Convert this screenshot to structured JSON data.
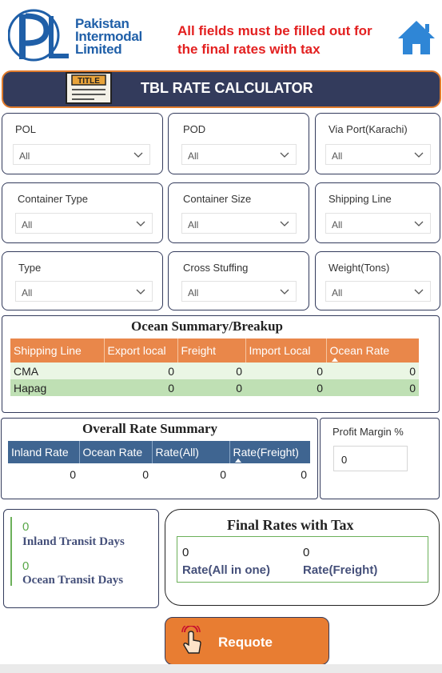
{
  "header": {
    "company_line1": "Pakistan",
    "company_line2": "Intermodal",
    "company_line3": "Limited",
    "notice_line1": "All fields must be filled out for",
    "notice_line2": "the final rates with tax",
    "home_icon": "home-icon",
    "logo_letters": "PL",
    "brand_color": "#1f5fa8",
    "notice_color": "#e32020"
  },
  "banner": {
    "title": "TBL RATE CALCULATOR",
    "icon_text": "TITLE",
    "background": "#333b5c",
    "border_color": "#e07b2c"
  },
  "filters": [
    {
      "label": "POL",
      "value": "All"
    },
    {
      "label": "POD",
      "value": "All"
    },
    {
      "label": "Via Port(Karachi)",
      "value": "All"
    },
    {
      "label": "Container Type",
      "value": "All"
    },
    {
      "label": "Container Size",
      "value": "All"
    },
    {
      "label": "Shipping Line",
      "value": "All"
    },
    {
      "label": "Type",
      "value": "All"
    },
    {
      "label": "Cross Stuffing",
      "value": "All"
    },
    {
      "label": "Weight(Tons)",
      "value": "All"
    }
  ],
  "ocean_summary": {
    "title": "Ocean Summary/Breakup",
    "columns": [
      "Shipping Line",
      "Export local",
      "Freight",
      "Import Local",
      "Ocean Rate"
    ],
    "sorted_column": "Ocean Rate",
    "rows": [
      [
        "CMA",
        "0",
        "0",
        "0",
        "0"
      ],
      [
        "Hapag",
        "0",
        "0",
        "0",
        "0"
      ]
    ],
    "header_color": "#e9874a"
  },
  "overall_summary": {
    "title": "Overall Rate Summary",
    "columns": [
      "Inland Rate",
      "Ocean Rate",
      "Rate(All)",
      "Rate(Freight)"
    ],
    "sorted_column": "Rate(Freight)",
    "rows": [
      [
        "0",
        "0",
        "0",
        "0"
      ]
    ],
    "header_color": "#3f6591"
  },
  "profit": {
    "label": "Profit Margin %",
    "value": "0"
  },
  "transit": {
    "inland_value": "0",
    "inland_label": "Inland Transit Days",
    "ocean_value": "0",
    "ocean_label": "Ocean Transit Days"
  },
  "final_rates": {
    "title": "Final Rates with Tax",
    "all_value": "0",
    "all_label": "Rate(All in one)",
    "freight_value": "0",
    "freight_label": "Rate(Freight)"
  },
  "requote": {
    "label": "Requote",
    "icon": "tap-hand-icon",
    "color": "#e87d32"
  }
}
